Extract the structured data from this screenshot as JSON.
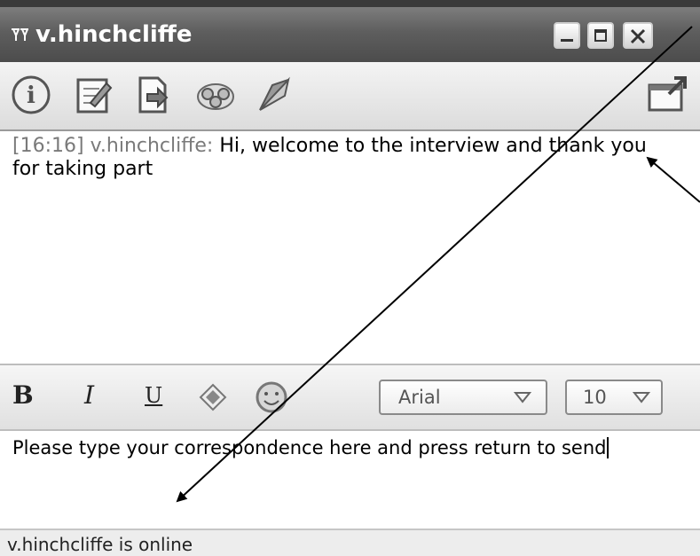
{
  "window": {
    "title": "v.hinchcliffe",
    "title_icon": "chat-app-icon",
    "controls": [
      "minimize-icon",
      "maximize-icon",
      "close-icon"
    ]
  },
  "toolbar": {
    "icons": [
      "info-icon",
      "edit-profile-icon",
      "send-file-icon",
      "conference-icon",
      "rocket-icon",
      "popout-icon"
    ]
  },
  "history": {
    "messages": [
      {
        "time": "[16:16]",
        "sender": "v.hinchcliffe:",
        "text": "Hi, welcome to the interview and thank you for taking part"
      }
    ]
  },
  "format_bar": {
    "bold_label": "B",
    "italic_label": "I",
    "underline_label": "U",
    "font_name": "Arial",
    "font_size": "10",
    "icons": [
      "color-icon",
      "smiley-icon"
    ]
  },
  "input": {
    "value": "Please type your correspondence here and press return to send"
  },
  "status": {
    "text": "v.hinchcliffe is online"
  },
  "colors": {
    "titlebar": "#5e5e5e",
    "timestamp": "#7a7a7a"
  }
}
